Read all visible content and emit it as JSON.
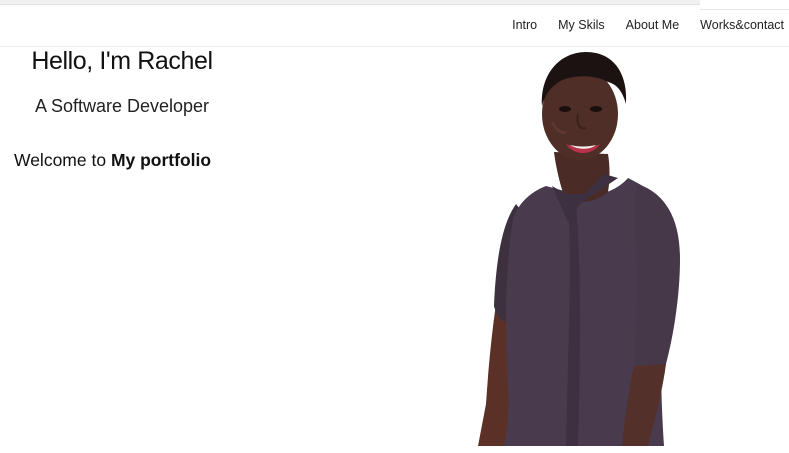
{
  "nav": {
    "items": [
      {
        "label": "Intro"
      },
      {
        "label": "My Skils"
      },
      {
        "label": "About Me"
      },
      {
        "label": "Works&contact"
      }
    ]
  },
  "hero": {
    "greeting": "Hello, I'm Rachel",
    "role": "A Software Developer",
    "welcome_prefix": "Welcome to ",
    "welcome_emphasis": "My portfolio"
  },
  "portrait": {
    "icon": "profile-photo",
    "colors": {
      "dress": "#4a3a4e",
      "skin": "#4b2c26",
      "hair": "#1c1211"
    }
  }
}
